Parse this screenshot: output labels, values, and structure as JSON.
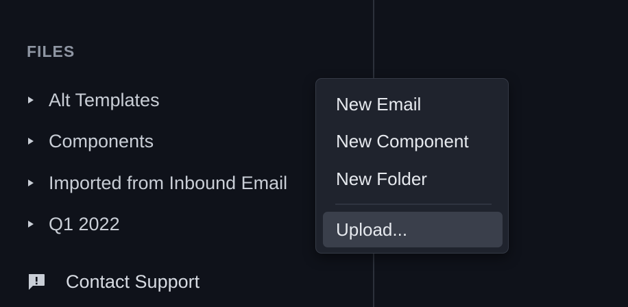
{
  "files": {
    "header": "FILES",
    "folders": [
      {
        "label": "Alt Templates"
      },
      {
        "label": "Components"
      },
      {
        "label": "Imported from Inbound Email"
      },
      {
        "label": "Q1 2022"
      }
    ]
  },
  "support": {
    "label": "Contact Support",
    "icon": "feedback-icon"
  },
  "context_menu": {
    "items": [
      {
        "label": "New Email"
      },
      {
        "label": "New Component"
      },
      {
        "label": "New Folder"
      },
      {
        "label": "Upload...",
        "active": true
      }
    ]
  },
  "colors": {
    "background": "#0f121a",
    "menu_background": "#1f232d",
    "menu_hover": "#3a3f4b",
    "text_primary": "#c9ced6",
    "text_muted": "#8f96a3"
  }
}
